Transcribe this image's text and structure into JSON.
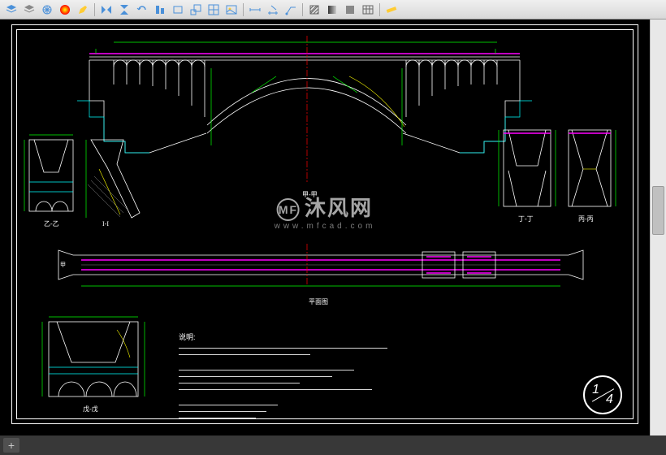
{
  "toolbar": {
    "tools": [
      "layers",
      "layer-states",
      "freeze",
      "color-wheel",
      "edit",
      "divider",
      "mirror",
      "mirror-v",
      "rotate",
      "align",
      "rectangle",
      "scale",
      "layout",
      "image",
      "divider",
      "dimension",
      "dim-edit",
      "leader",
      "divider",
      "hatch",
      "gradient",
      "region",
      "table",
      "divider",
      "measure"
    ]
  },
  "drawing": {
    "elevation_label": "甲-甲",
    "plan_label": "平面图",
    "sections": {
      "s1": "乙-乙",
      "s2": "I-I",
      "s3": "丁-丁",
      "s4": "丙-丙",
      "s5": "戊-戊"
    },
    "marker_left": "甲",
    "sheet_number": "1/4",
    "notes_title": "说明:"
  },
  "watermark": {
    "brand": "沐风网",
    "logo": "MF",
    "url": "www.mfcad.com"
  },
  "tabbar": {
    "add": "+"
  }
}
